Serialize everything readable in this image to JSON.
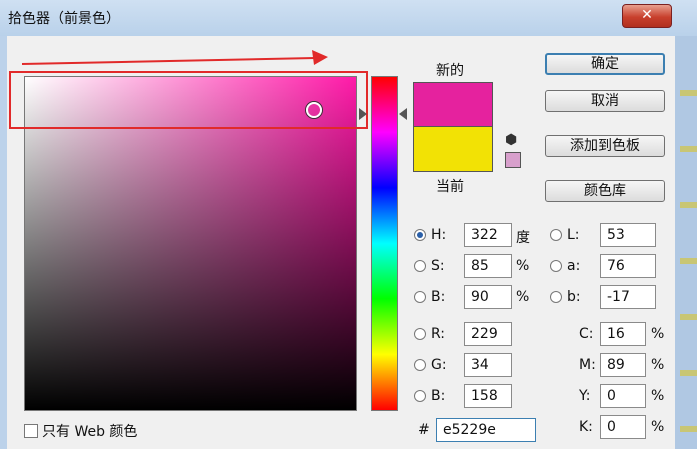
{
  "window": {
    "title": "拾色器（前景色）",
    "close_label": "✕"
  },
  "preview": {
    "new_label": "新的",
    "current_label": "当前",
    "new_color": "#e5229e",
    "current_color": "#f2e205",
    "websafe_color": "#d8a0cc"
  },
  "buttons": {
    "ok": "确定",
    "cancel": "取消",
    "add_to_swatches": "添加到色板",
    "color_libraries": "颜色库"
  },
  "hsb": [
    {
      "label": "H:",
      "value": "322",
      "unit": "度",
      "checked": true
    },
    {
      "label": "S:",
      "value": "85",
      "unit": "%",
      "checked": false
    },
    {
      "label": "B:",
      "value": "90",
      "unit": "%",
      "checked": false
    }
  ],
  "lab": [
    {
      "label": "L:",
      "value": "53"
    },
    {
      "label": "a:",
      "value": "76"
    },
    {
      "label": "b:",
      "value": "-17"
    }
  ],
  "rgb": [
    {
      "label": "R:",
      "value": "229"
    },
    {
      "label": "G:",
      "value": "34"
    },
    {
      "label": "B:",
      "value": "158"
    }
  ],
  "cmyk": [
    {
      "label": "C:",
      "value": "16",
      "unit": "%"
    },
    {
      "label": "M:",
      "value": "89",
      "unit": "%"
    },
    {
      "label": "Y:",
      "value": "0",
      "unit": "%"
    },
    {
      "label": "K:",
      "value": "0",
      "unit": "%"
    }
  ],
  "hex": {
    "prefix": "#",
    "value": "e5229e"
  },
  "web_only": {
    "label": "只有 Web 颜色"
  },
  "colors": {
    "annotation_red": "#e12a2a",
    "field_hue": "#ff1aa8"
  }
}
